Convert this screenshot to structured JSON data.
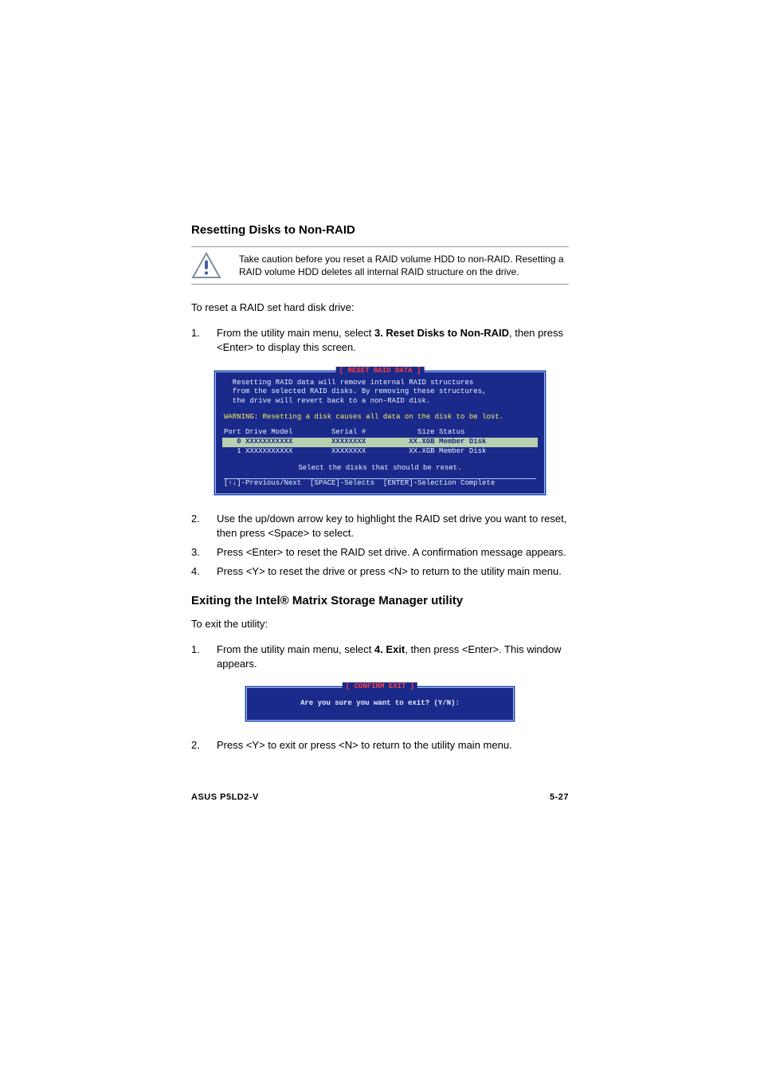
{
  "section1": {
    "heading": "Resetting Disks to Non-RAID",
    "caution": "Take caution before you reset a RAID volume HDD to non-RAID. Resetting a RAID volume HDD deletes all internal RAID structure on the drive.",
    "intro": "To reset a RAID set hard disk drive:",
    "steps": {
      "s1_num": "1.",
      "s1_a": "From the utility main menu, select ",
      "s1_b": "3. Reset Disks to Non-RAID",
      "s1_c": ", then press <Enter> to display this screen.",
      "s2_num": "2.",
      "s2": "Use the up/down arrow key to highlight the RAID set drive you want to reset, then press <Space> to select.",
      "s3_num": "3.",
      "s3": "Press <Enter> to reset the RAID set drive. A confirmation message appears.",
      "s4_num": "4.",
      "s4": "Press <Y> to reset the drive or press <N> to return to the utility main menu."
    }
  },
  "bios1": {
    "title": "[ RESET RAID DATA ]",
    "l1": "  Resetting RAID data will remove internal RAID structures",
    "l2": "  from the selected RAID disks. By removing these structures,",
    "l3": "  the drive will revert back to a non-RAID disk.",
    "warn": "WARNING: Resetting a disk causes all data on the disk to be lost.",
    "hdr": "Port Drive Model         Serial #            Size Status",
    "row0": "   0 XXXXXXXXXXX         XXXXXXXX          XX.XGB Member Disk  ",
    "row1": "   1 XXXXXXXXXXX         XXXXXXXX          XX.XGB Member Disk",
    "prompt": "Select the disks that should be reset.",
    "foot": "[↑↓]-Previous/Next  [SPACE]-Selects  [ENTER]-Selection Complete"
  },
  "section2": {
    "heading": "Exiting the Intel® Matrix Storage Manager utility",
    "intro": "To exit the utility:",
    "steps": {
      "s1_num": "1.",
      "s1_a": "From the utility main menu, select ",
      "s1_b": "4. Exit",
      "s1_c": ", then press <Enter>. This window appears.",
      "s2_num": "2.",
      "s2": "Press <Y> to exit or press <N> to return to the utility main menu."
    }
  },
  "bios2": {
    "title": "[ CONFIRM EXIT ]",
    "msg": "Are you sure you want to exit? (Y/N):"
  },
  "footer": {
    "left": "ASUS P5LD2-V",
    "right": "5-27"
  }
}
